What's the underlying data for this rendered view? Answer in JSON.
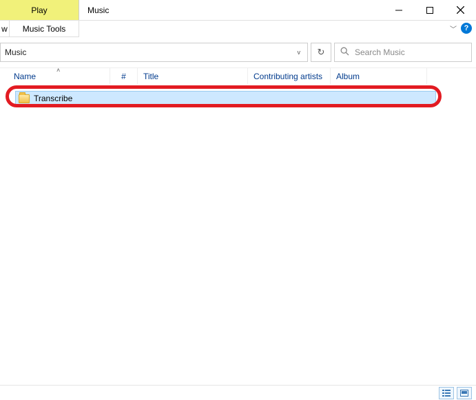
{
  "titlebar": {
    "tab_play": "Play",
    "title": "Music"
  },
  "ribbon": {
    "tab_w": "w",
    "tab_music_tools": "Music Tools"
  },
  "address": {
    "path": "Music"
  },
  "search": {
    "placeholder": "Search Music"
  },
  "columns": {
    "name": "Name",
    "num": "#",
    "title": "Title",
    "contributing": "Contributing artists",
    "album": "Album"
  },
  "rows": [
    {
      "name": "Transcribe"
    }
  ],
  "help": {
    "glyph": "?"
  }
}
